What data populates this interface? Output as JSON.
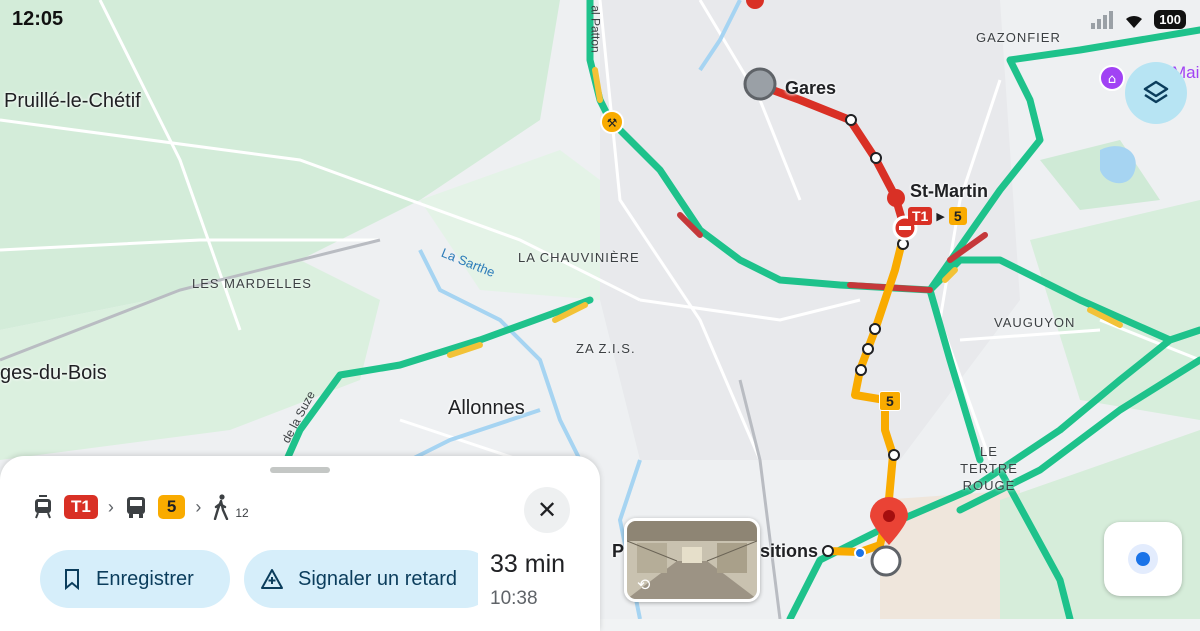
{
  "status_bar": {
    "time": "12:05",
    "battery": "100"
  },
  "map": {
    "towns": [
      {
        "name": "Pruillé-le-Chétif"
      },
      {
        "name": "ges-du-Bois"
      },
      {
        "name": "Allonnes"
      }
    ],
    "districts": [
      {
        "name": "LES MARDELLES"
      },
      {
        "name": "LA CHAUVINIÈRE"
      },
      {
        "name": "ZA Z.I.S."
      },
      {
        "name": "VAUGUYON"
      },
      {
        "name": "LE TERTRE ROUGE"
      },
      {
        "name": "GAZONFIER"
      }
    ],
    "river_label": "La Sarthe",
    "road_labels": [
      "de la Suze",
      "al Patton"
    ],
    "poi_fragment": "Mai\ne",
    "stations": {
      "origin": "Gares",
      "transfer": "St-Martin",
      "destination_left": "P",
      "destination_right": "sitions"
    },
    "transfer_badges": {
      "tram": "T1",
      "bus": "5"
    },
    "bus_route_badge": "5",
    "colors": {
      "tram_line": "#d93025",
      "bus_line": "#f9ab00",
      "traffic_good": "#1ec28b",
      "water": "#a6d4f2",
      "park": "#cfead6",
      "destination_pin": "#ea4335"
    }
  },
  "trip_sheet": {
    "steps": [
      {
        "icon": "tram-icon",
        "badge": "T1"
      },
      {
        "icon": "bus-icon",
        "badge": "5"
      },
      {
        "icon": "walk-icon",
        "minutes": "12"
      }
    ],
    "save_label": "Enregistrer",
    "report_label": "Signaler un retard",
    "duration": "33 min",
    "arrival": "10:38"
  }
}
